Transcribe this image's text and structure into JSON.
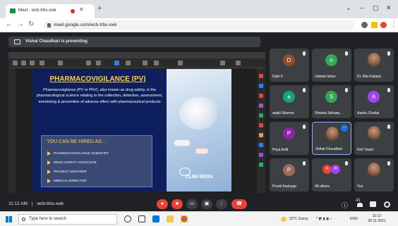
{
  "browser": {
    "tab_title": "Meet - wcb-trbs-xwk",
    "new_tab": "+",
    "url": "meet.google.com/wcb-trbs-xwk",
    "window_controls": [
      "⌄",
      "–",
      "▢",
      "✕"
    ]
  },
  "meeting": {
    "presenting_banner": "Vishal Chaudhari is presenting",
    "time": "11:12 AM",
    "separator": "|",
    "code": "wcb-trbs-xwk"
  },
  "slide": {
    "title": "PHARMACOVIGILANCE (PV)",
    "body": "Pharmacovigilance (PV or PhV), also known as drug safety, is the pharmacological science relating to the collection, detection, assessment, monitoring & prevention of adverse effect with pharmaceutical products",
    "hired_title": "YOU CAN BE HIRED AS…",
    "hired_items": [
      "PHARMACOVIGILANCE SCIENTIST",
      "DRUG SAFETY ASSOCIATE",
      "PROJECT MANAGER",
      "MEDICAL DIRECTOR"
    ],
    "brand": "CLINI INDIA"
  },
  "participants": [
    {
      "name": "Dipti S",
      "initial": "D",
      "color": "#8d4c2e"
    },
    {
      "name": "nisham lohan",
      "initial": "n",
      "color": "#34a853"
    },
    {
      "name": "Dr. Ritu Kataria",
      "initial": "",
      "color": "#5f6368"
    },
    {
      "name": "anjali Sharma",
      "initial": "a",
      "color": "#12a37a"
    },
    {
      "name": "Shweta Sehraw...",
      "initial": "S",
      "color": "#34a853"
    },
    {
      "name": "Aashu Chahal",
      "initial": "A",
      "color": "#a142f4"
    },
    {
      "name": "Priya Antil",
      "initial": "P",
      "color": "#8e24aa"
    },
    {
      "name": "Vishal Chaudhari",
      "initial": "",
      "color": "#5f6368"
    },
    {
      "name": "Kirti Tiwari",
      "initial": "",
      "color": "#5f6368"
    },
    {
      "name": "Preeti Kashyap",
      "initial": "P",
      "color": "#9e6b5a"
    },
    {
      "name": "49 others",
      "initial": "",
      "color": "#5f6368"
    },
    {
      "name": "You",
      "initial": "",
      "color": "#5f6368"
    }
  ],
  "others_avatars": [
    "A",
    "N"
  ],
  "taskbar": {
    "search_placeholder": "Type here to search",
    "tray_text": "32°C Sunny",
    "lang": "ENG",
    "clock_time": "11:12",
    "clock_date": "30-11-2021"
  },
  "icons": {
    "more_options": "⋮",
    "end_call": "☎",
    "info": "ⓘ",
    "people_count": "41"
  }
}
